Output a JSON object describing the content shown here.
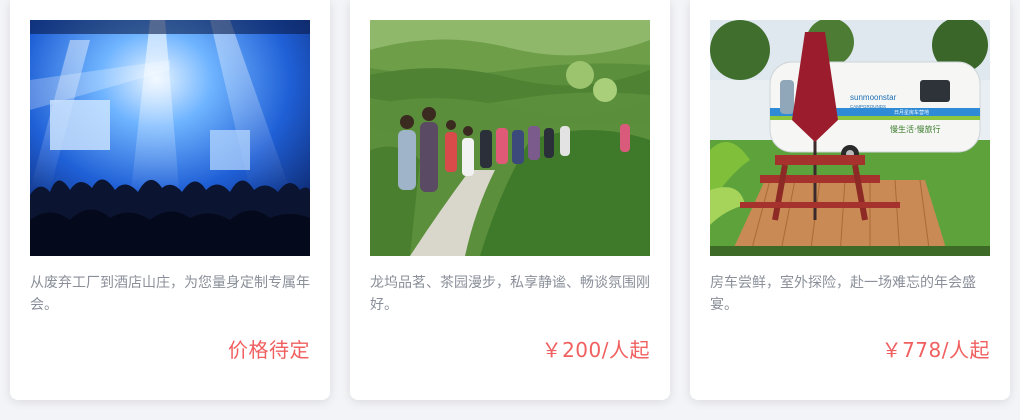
{
  "cards": [
    {
      "description": "从废弃工厂到酒店山庄，为您量身定制专属年会。",
      "price": "价格待定",
      "photo": "concert-stage-photo"
    },
    {
      "description": "龙坞品茗、茶园漫步，私享静谧、畅谈氛围刚好。",
      "price": "￥200/人起",
      "photo": "tea-garden-group-photo"
    },
    {
      "description": "房车尝鲜，室外探险，赴一场难忘的年会盛宴。",
      "price": "￥778/人起",
      "photo": "rv-camping-photo",
      "photo_sign": "sunmoonstar",
      "photo_sign_sub": "CAMPGROUNDS",
      "photo_sign_banner": "日月星房车营地",
      "photo_sign_slogan": "慢生活·慢旅行"
    }
  ],
  "colors": {
    "price": "#f06060",
    "description": "#8a8f99",
    "card_bg": "#ffffff",
    "page_bg": "#f3f4f7"
  }
}
